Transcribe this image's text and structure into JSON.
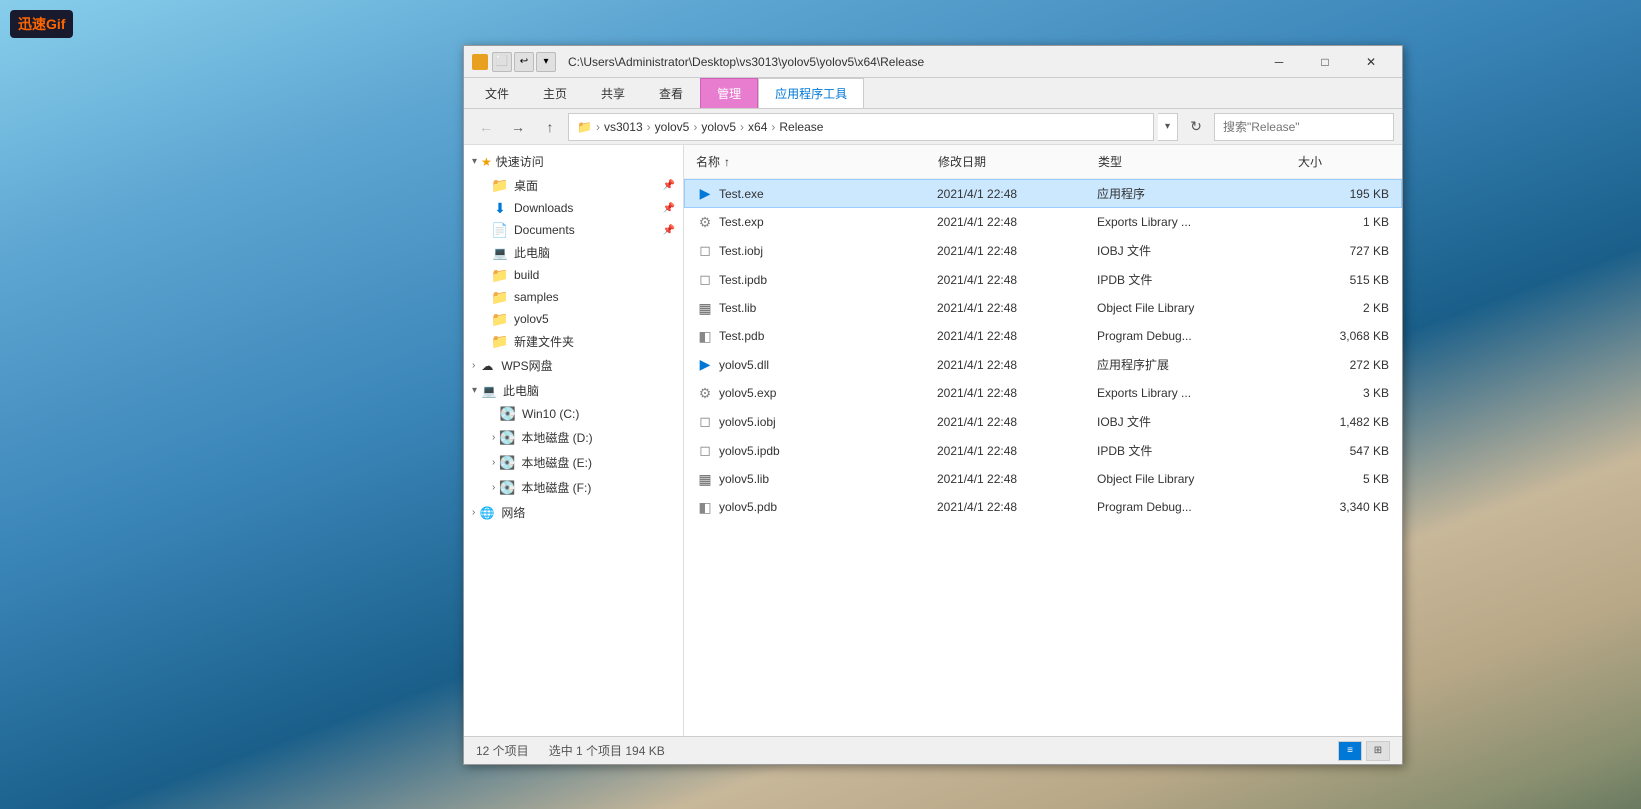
{
  "logo": {
    "brand": "迅速",
    "suffix": "Gif"
  },
  "window": {
    "title": "C:\\Users\\Administrator\\Desktop\\vs3013\\yolov5\\yolov5\\x64\\Release",
    "title_short": "Release",
    "minimize": "─",
    "maximize": "□",
    "close": "✕"
  },
  "ribbon": {
    "tabs": [
      "文件",
      "主页",
      "共享",
      "查看",
      "应用程序工具"
    ],
    "active_tab": "应用程序工具",
    "pink_tab": "管理"
  },
  "nav": {
    "back": "←",
    "forward": "→",
    "up": "↑",
    "breadcrumb": [
      "vs3013",
      "yolov5",
      "yolov5",
      "x64",
      "Release"
    ],
    "search_placeholder": "搜索\"Release\"",
    "refresh": "↻"
  },
  "sidebar": {
    "quick_access_label": "快速访问",
    "items": [
      {
        "name": "桌面",
        "type": "folder",
        "pinned": true
      },
      {
        "name": "Downloads",
        "type": "downloads",
        "pinned": true
      },
      {
        "name": "Documents",
        "type": "documents",
        "pinned": true
      },
      {
        "name": "此电脑",
        "type": "computer"
      },
      {
        "name": "build",
        "type": "folder"
      },
      {
        "name": "samples",
        "type": "folder"
      },
      {
        "name": "yolov5",
        "type": "folder"
      },
      {
        "name": "新建文件夹",
        "type": "folder"
      }
    ],
    "wps_label": "WPS网盘",
    "computer_label": "此电脑",
    "drives": [
      {
        "name": "Win10 (C:)"
      },
      {
        "name": "本地磁盘 (D:)"
      },
      {
        "name": "本地磁盘 (E:)"
      },
      {
        "name": "本地磁盘 (F:)"
      }
    ],
    "network_label": "网络"
  },
  "file_list": {
    "columns": [
      "名称",
      "修改日期",
      "类型",
      "大小"
    ],
    "sort_col": "名称",
    "sort_dir": "↑",
    "files": [
      {
        "name": "Test.exe",
        "date": "2021/4/1 22:48",
        "type": "应用程序",
        "size": "195 KB",
        "icon": "exe",
        "selected": true
      },
      {
        "name": "Test.exp",
        "date": "2021/4/1 22:48",
        "type": "Exports Library ...",
        "size": "1 KB",
        "icon": "exp",
        "selected": false
      },
      {
        "name": "Test.iobj",
        "date": "2021/4/1 22:48",
        "type": "IOBJ 文件",
        "size": "727 KB",
        "icon": "obj",
        "selected": false
      },
      {
        "name": "Test.ipdb",
        "date": "2021/4/1 22:48",
        "type": "IPDB 文件",
        "size": "515 KB",
        "icon": "obj",
        "selected": false
      },
      {
        "name": "Test.lib",
        "date": "2021/4/1 22:48",
        "type": "Object File Library",
        "size": "2 KB",
        "icon": "lib",
        "selected": false
      },
      {
        "name": "Test.pdb",
        "date": "2021/4/1 22:48",
        "type": "Program Debug...",
        "size": "3,068 KB",
        "icon": "pdb",
        "selected": false
      },
      {
        "name": "yolov5.dll",
        "date": "2021/4/1 22:48",
        "type": "应用程序扩展",
        "size": "272 KB",
        "icon": "dll",
        "selected": false
      },
      {
        "name": "yolov5.exp",
        "date": "2021/4/1 22:48",
        "type": "Exports Library ...",
        "size": "3 KB",
        "icon": "exp",
        "selected": false
      },
      {
        "name": "yolov5.iobj",
        "date": "2021/4/1 22:48",
        "type": "IOBJ 文件",
        "size": "1,482 KB",
        "icon": "obj",
        "selected": false
      },
      {
        "name": "yolov5.ipdb",
        "date": "2021/4/1 22:48",
        "type": "IPDB 文件",
        "size": "547 KB",
        "icon": "obj",
        "selected": false
      },
      {
        "name": "yolov5.lib",
        "date": "2021/4/1 22:48",
        "type": "Object File Library",
        "size": "5 KB",
        "icon": "lib",
        "selected": false
      },
      {
        "name": "yolov5.pdb",
        "date": "2021/4/1 22:48",
        "type": "Program Debug...",
        "size": "3,340 KB",
        "icon": "pdb",
        "selected": false
      }
    ]
  },
  "status": {
    "total": "12 个项目",
    "selected": "选中 1 个项目  194 KB"
  }
}
